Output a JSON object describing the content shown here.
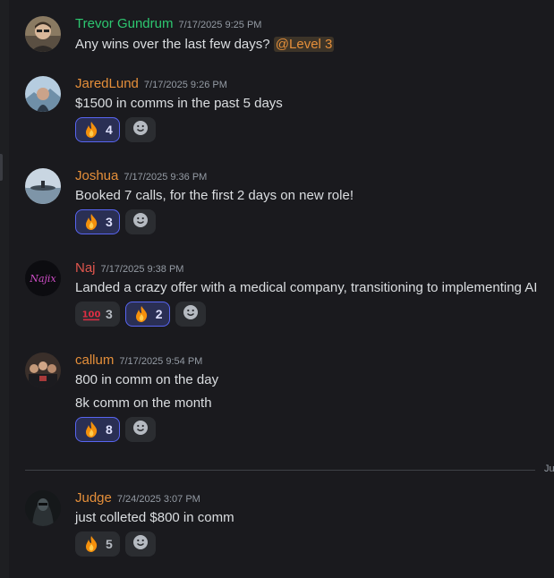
{
  "top_corner_text": "J",
  "divider_label": "Ju",
  "messages": [
    {
      "author": "Trevor Gundrum",
      "author_color": "#2dc770",
      "timestamp": "7/17/2025 9:25 PM",
      "lines": [
        "Any wins over the last few days?"
      ],
      "mention": "@Level 3",
      "reactions": []
    },
    {
      "author": "JaredLund",
      "author_color": "#e58f3a",
      "timestamp": "7/17/2025 9:26 PM",
      "lines": [
        "$1500 in comms in the past 5 days"
      ],
      "reactions": [
        {
          "emoji": "fire-emoji",
          "count": "4",
          "self": true
        }
      ]
    },
    {
      "author": "Joshua",
      "author_color": "#e58f3a",
      "timestamp": "7/17/2025 9:36 PM",
      "lines": [
        "Booked 7 calls, for the first 2 days on new role!"
      ],
      "reactions": [
        {
          "emoji": "fire-emoji",
          "count": "3",
          "self": true
        }
      ]
    },
    {
      "author": "Naj",
      "author_color": "#e0564d",
      "timestamp": "7/17/2025 9:38 PM",
      "lines": [
        "Landed a crazy offer with a medical company, transitioning to implementing AI"
      ],
      "avatar_text": "Najix",
      "reactions": [
        {
          "emoji": "hundred-emoji",
          "count": "3",
          "self": false
        },
        {
          "emoji": "fire-emoji",
          "count": "2",
          "self": true
        }
      ]
    },
    {
      "author": "callum",
      "author_color": "#e58f3a",
      "timestamp": "7/17/2025 9:54 PM",
      "lines": [
        "800 in comm on the day",
        "8k comm on the month"
      ],
      "reactions": [
        {
          "emoji": "fire-emoji",
          "count": "8",
          "self": true
        }
      ]
    },
    {
      "author": "Judge",
      "author_color": "#e58f3a",
      "timestamp": "7/24/2025 3:07 PM",
      "lines": [
        "just colleted $800 in comm"
      ],
      "reactions": [
        {
          "emoji": "fire-emoji",
          "count": "5",
          "self": false
        }
      ]
    }
  ]
}
